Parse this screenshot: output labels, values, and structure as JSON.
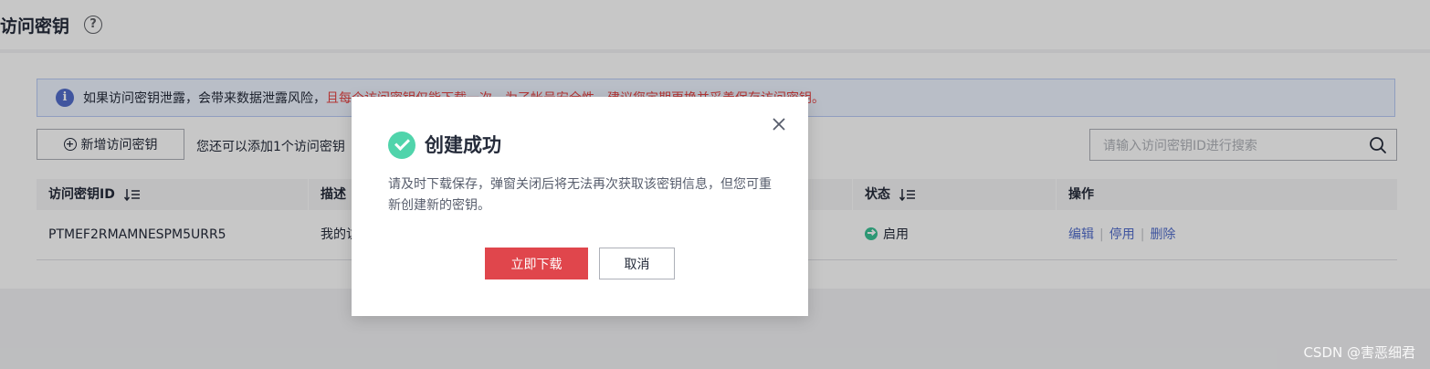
{
  "page": {
    "title": "访问密钥"
  },
  "banner": {
    "text": "如果访问密钥泄露，会带来数据泄露风险，",
    "warning": "且每个访问密钥仅能下载一次，为了帐号安全性，建议您定期更换并妥善保存访问密钥。"
  },
  "toolbar": {
    "add_label": "新增访问密钥",
    "quota": "您还可以添加1个访问密钥",
    "search_placeholder": "请输入访问密钥ID进行搜索"
  },
  "table": {
    "columns": [
      "访问密钥ID",
      "描述",
      "状态",
      "操作"
    ],
    "rows": [
      {
        "id": "PTMEF2RMAMNESPM5URR5",
        "description": "我的访问密钥",
        "status": "启用",
        "actions": [
          "编辑",
          "停用",
          "删除"
        ]
      }
    ]
  },
  "modal": {
    "title": "创建成功",
    "message": "请及时下载保存，弹窗关闭后将无法再次获取该密钥信息，但您可重新创建新的密钥。",
    "primary_label": "立即下载",
    "secondary_label": "取消"
  },
  "watermark": "CSDN @害恶细君",
  "colors": {
    "accent": "#526ecc",
    "danger": "#e0464c",
    "success": "#50d4ab"
  }
}
